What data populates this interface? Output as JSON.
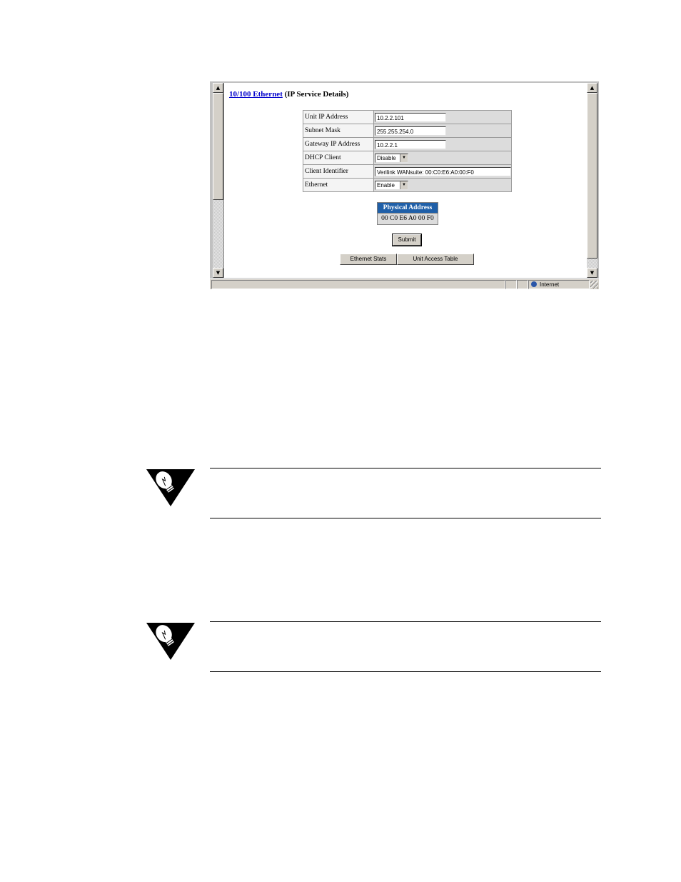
{
  "stray_mark": ",",
  "browser": {
    "status": {
      "zone_label": "Internet"
    },
    "page": {
      "heading_link": "10/100 Ethernet",
      "heading_rest": " (IP Service Details)",
      "fields": [
        {
          "label": "Unit IP Address",
          "value": "10.2.2.101",
          "kind": "text"
        },
        {
          "label": "Subnet Mask",
          "value": "255.255.254.0",
          "kind": "text"
        },
        {
          "label": "Gateway IP Address",
          "value": "10.2.2.1",
          "kind": "text"
        },
        {
          "label": "DHCP Client",
          "value": "Disable",
          "kind": "select"
        },
        {
          "label": "Client Identifier",
          "value": "Verilink WANsuite: 00:C0:E6:A0:00:F0",
          "kind": "text"
        },
        {
          "label": "Ethernet",
          "value": "Enable",
          "kind": "select"
        }
      ],
      "physical_address": {
        "header": "Physical Address",
        "value": "00 C0 E6 A0 00 F0"
      },
      "submit_label": "Submit",
      "ethernet_stats_label": "Ethernet Stats",
      "unit_access_table_label": "Unit Access Table"
    }
  },
  "notes": [
    {
      "icon": "lightbulb-note-icon"
    },
    {
      "icon": "lightbulb-note-icon"
    }
  ]
}
